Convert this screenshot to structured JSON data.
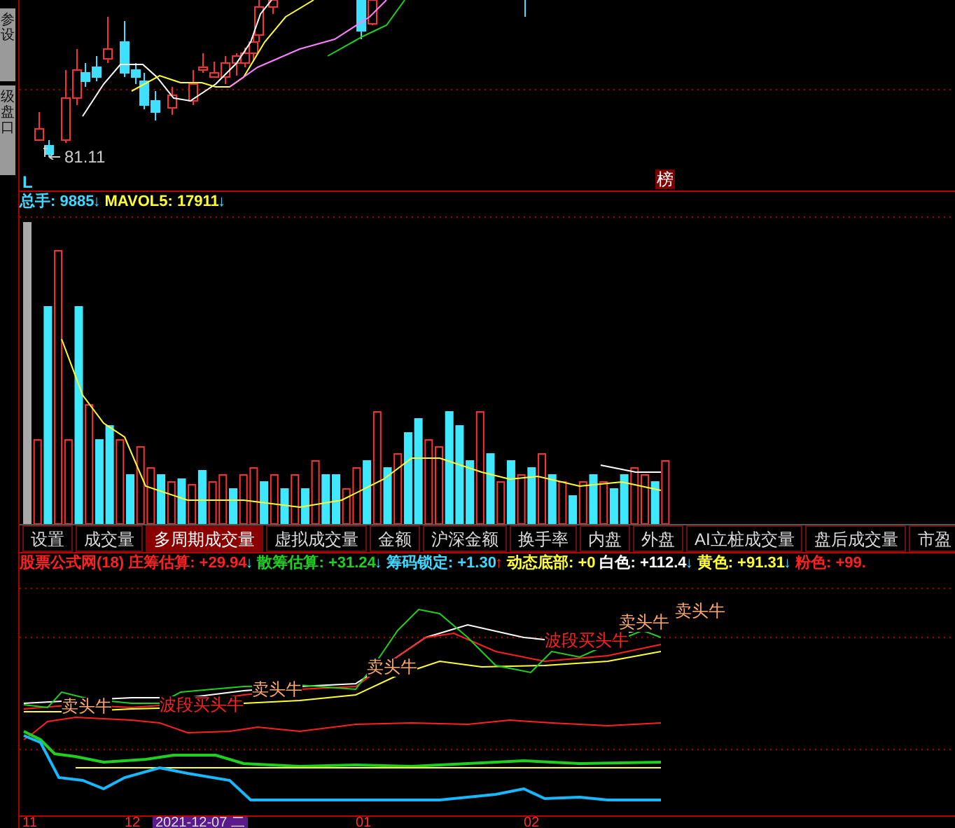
{
  "side_tabs": [
    {
      "label": "参设"
    },
    {
      "label": "级盘口"
    }
  ],
  "price_panel": {
    "low_label": "81.11",
    "period_mark": "L",
    "badge": "榜"
  },
  "volume_legend": [
    {
      "label": "总手: 9885",
      "arrow": "↓",
      "color": "#3fd8ff"
    },
    {
      "label": "MAVOL5: 17911",
      "arrow": "↓",
      "color": "#ffff33"
    }
  ],
  "tabs": [
    {
      "label": "设置",
      "selected": false
    },
    {
      "label": "成交量",
      "selected": false
    },
    {
      "label": "多周期成交量",
      "selected": true
    },
    {
      "label": "虚拟成交量",
      "selected": false
    },
    {
      "label": "金额",
      "selected": false
    },
    {
      "label": "沪深金额",
      "selected": false
    },
    {
      "label": "换手率",
      "selected": false
    },
    {
      "label": "内盘",
      "selected": false
    },
    {
      "label": "外盘",
      "selected": false
    },
    {
      "label": "AI立桩成交量",
      "selected": false
    },
    {
      "label": "盘后成交量",
      "selected": false
    },
    {
      "label": "市盈",
      "selected": false
    }
  ],
  "indicator_legend": [
    {
      "label": "股票公式网(18)",
      "color": "#ff2020"
    },
    {
      "label": "庄筹估算: +29.94",
      "arrow": "↓",
      "color": "#ff2020"
    },
    {
      "label": "散筹估算: +31.24",
      "arrow": "↓",
      "color": "#20d020"
    },
    {
      "label": "筹码锁定: +1.30",
      "arrow": "↑",
      "color": "#3fd8ff"
    },
    {
      "label": "动态底部: +0",
      "color": "#ffff33"
    },
    {
      "label": "白色: +112.4",
      "arrow": "↓",
      "color": "#ffffff"
    },
    {
      "label": "黄色: +91.31",
      "arrow": "↓",
      "color": "#ffff33"
    },
    {
      "label": "粉色: +99.",
      "color": "#ff2020"
    }
  ],
  "signals": [
    {
      "text": "卖头牛",
      "kind": "sell"
    },
    {
      "text": "波段买头牛",
      "kind": "buy"
    },
    {
      "text": "卖头牛",
      "kind": "sell"
    },
    {
      "text": "卖头牛",
      "kind": "sell"
    },
    {
      "text": "波段买头牛",
      "kind": "buy"
    },
    {
      "text": "卖头牛",
      "kind": "sell"
    },
    {
      "text": "卖头牛",
      "kind": "sell"
    }
  ],
  "x_axis": [
    {
      "label": "11",
      "kind": "tick"
    },
    {
      "label": "12",
      "kind": "tick"
    },
    {
      "label": "2021-12-07 二",
      "kind": "cursor"
    },
    {
      "label": "01",
      "kind": "tick"
    },
    {
      "label": "02",
      "kind": "tick"
    }
  ]
}
